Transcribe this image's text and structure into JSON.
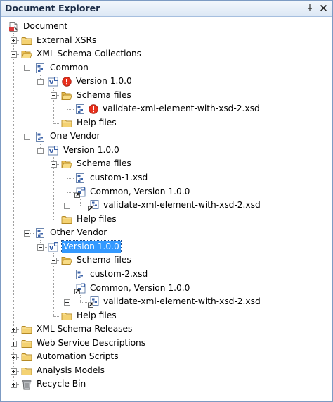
{
  "window": {
    "title": "Document Explorer",
    "pin_icon": "pin-icon",
    "close_icon": "close-icon"
  },
  "tree": {
    "root": "Document",
    "external_xsrs": "External XSRs",
    "xml_schema_collections": "XML Schema Collections",
    "common": {
      "label": "Common",
      "version": "Version 1.0.0",
      "schema_files": "Schema files",
      "schema_file_1": "validate-xml-element-with-xsd-2.xsd",
      "help_files": "Help files"
    },
    "one_vendor": {
      "label": "One Vendor",
      "version": "Version 1.0.0",
      "schema_files": "Schema files",
      "custom_file": "custom-1.xsd",
      "common_ref": "Common, Version 1.0.0",
      "common_ref_file": "validate-xml-element-with-xsd-2.xsd",
      "help_files": "Help files"
    },
    "other_vendor": {
      "label": "Other Vendor",
      "version": "Version 1.0.0",
      "schema_files": "Schema files",
      "custom_file": "custom-2.xsd",
      "common_ref": "Common, Version 1.0.0",
      "common_ref_file": "validate-xml-element-with-xsd-2.xsd",
      "help_files": "Help files"
    },
    "xml_schema_releases": "XML Schema Releases",
    "web_service_descriptions": "Web Service Descriptions",
    "automation_scripts": "Automation Scripts",
    "analysis_models": "Analysis Models",
    "recycle_bin": "Recycle Bin"
  },
  "colors": {
    "selection": "#3399ff",
    "folder": "#f2c95c",
    "error": "#e8301c",
    "title_bg": "#dde8f5"
  }
}
